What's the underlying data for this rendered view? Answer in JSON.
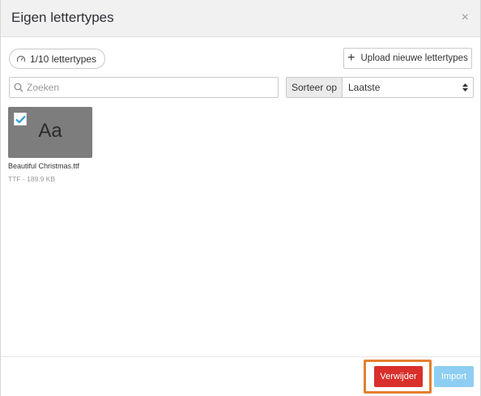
{
  "dialog": {
    "title": "Eigen lettertypes",
    "close_symbol": "×"
  },
  "toolbar": {
    "quota_label": "1/10 lettertypes",
    "quota_icon": "gauge-icon",
    "upload_label": "Upload nieuwe lettertypes",
    "upload_icon": "plus-icon"
  },
  "search": {
    "placeholder": "Zoeken",
    "value": ""
  },
  "sort": {
    "label": "Sorteer op",
    "selected": "Laatste"
  },
  "fonts": [
    {
      "preview": "Aa",
      "name": "Beautiful Christmas.ttf",
      "meta": "TTF - 189.9 KB",
      "selected": true
    }
  ],
  "footer": {
    "delete_label": "Verwijder",
    "import_label": "Import"
  },
  "colors": {
    "delete": "#d9302b",
    "import": "#8dcef2",
    "highlight": "#e57f2e",
    "check": "#2a9fd8"
  }
}
